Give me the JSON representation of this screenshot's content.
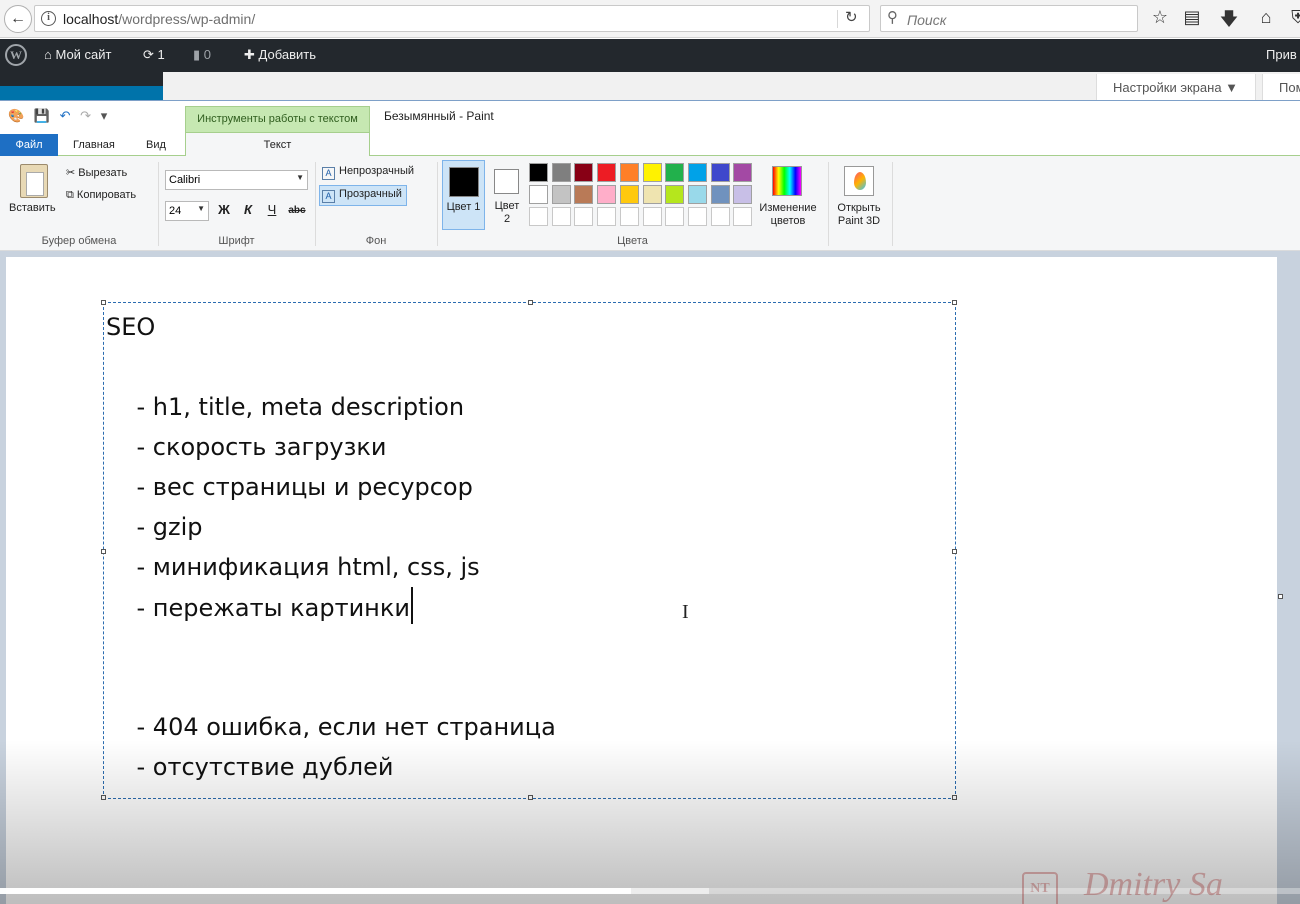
{
  "browser": {
    "back_icon": "back-arrow-icon",
    "url_host": "localhost",
    "url_path": "/wordpress/wp-admin/",
    "search_placeholder": "Поиск",
    "toolbar_icons": [
      "bookmark-star-icon",
      "reading-list-icon",
      "download-icon",
      "home-icon",
      "shield-icon"
    ]
  },
  "wp_admin_bar": {
    "site_name": "Мой сайт",
    "updates_count": "1",
    "comments_count": "0",
    "add_new": "Добавить",
    "greeting": "Прив",
    "screen_options": "Настройки экрана ▼",
    "help": "Пом"
  },
  "paint": {
    "context_tab": "Инструменты работы с текстом",
    "window_title": "Безымянный - Paint",
    "tabs": {
      "file": "Файл",
      "home": "Главная",
      "view": "Вид",
      "text": "Текст"
    },
    "clipboard": {
      "paste": "Вставить",
      "cut": "Вырезать",
      "copy": "Копировать",
      "group": "Буфер обмена"
    },
    "font": {
      "family": "Calibri",
      "size": "24",
      "bold": "Ж",
      "italic": "К",
      "underline": "Ч",
      "strike": "abc",
      "group": "Шрифт"
    },
    "background": {
      "opaque": "Непрозрачный",
      "transparent": "Прозрачный",
      "selected": "transparent",
      "group": "Фон"
    },
    "colors": {
      "color1_label": "Цвет 1",
      "color2_label": "Цвет 2",
      "color1": "#000000",
      "color2": "#ffffff",
      "palette_row1": [
        "#000000",
        "#7f7f7f",
        "#880015",
        "#ed1c24",
        "#ff7f27",
        "#fff200",
        "#22b14c",
        "#00a2e8",
        "#3f48cc",
        "#a349a4"
      ],
      "palette_row2": [
        "#ffffff",
        "#c3c3c3",
        "#b97a57",
        "#ffaec9",
        "#ffc90e",
        "#efe4b0",
        "#b5e61d",
        "#99d9ea",
        "#7092be",
        "#c8bfe7"
      ],
      "edit_colors": "Изменение цветов",
      "open_paint3d": "Открыть Paint 3D",
      "group": "Цвета"
    },
    "canvas_text": [
      "SEO",
      "",
      "    - h1, title, meta description",
      "    - скорость загрузки",
      "    - вес страницы и ресурсор",
      "    - gzip",
      "    - минификация html, css, js",
      "    - пережаты картинки",
      "",
      "",
      "    - 404 ошибка, если нет страница",
      "    - отсутствие дублей"
    ]
  },
  "video": {
    "progress": 0.485,
    "buffered": 0.545,
    "watermark_badge": "NT",
    "watermark_name": "Dmitry Sa"
  }
}
